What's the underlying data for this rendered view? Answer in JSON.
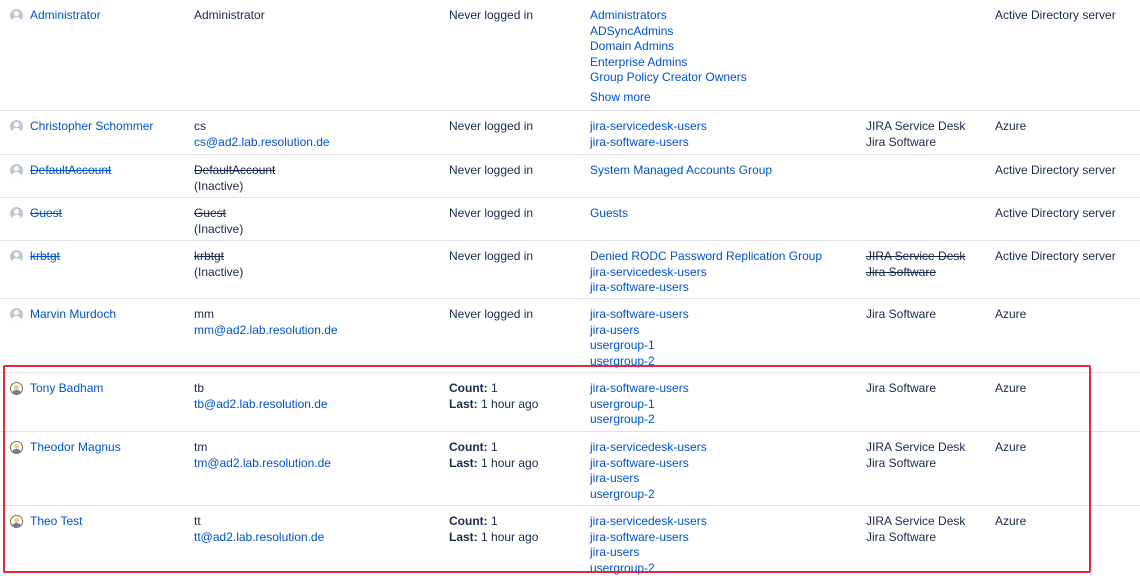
{
  "rows": [
    {
      "name": "Administrator",
      "name_inactive": false,
      "avatar": "default-avatar-icon",
      "username": "Administrator",
      "email": "",
      "inactive_label": "",
      "login_status": "Never logged in",
      "groups": [
        "Administrators",
        "ADSyncAdmins",
        "Domain Admins",
        "Enterprise Admins",
        "Group Policy Creator Owners"
      ],
      "show_more": "Show more",
      "apps": [],
      "apps_struck": false,
      "directory": "Active Directory server"
    },
    {
      "name": "Christopher Schommer",
      "name_inactive": false,
      "avatar": "default-avatar-icon",
      "username": "cs",
      "email": "cs@ad2.lab.resolution.de",
      "inactive_label": "",
      "login_status": "Never logged in",
      "groups": [
        "jira-servicedesk-users",
        "jira-software-users"
      ],
      "apps": [
        "JIRA Service Desk",
        "Jira Software"
      ],
      "apps_struck": false,
      "directory": "Azure"
    },
    {
      "name": "DefaultAccount",
      "name_inactive": true,
      "avatar": "default-avatar-icon",
      "username": "DefaultAccount",
      "email": "",
      "inactive_label": "(Inactive)",
      "login_status": "Never logged in",
      "groups": [
        "System Managed Accounts Group"
      ],
      "apps": [],
      "apps_struck": false,
      "directory": "Active Directory server"
    },
    {
      "name": "Guest",
      "name_inactive": true,
      "avatar": "default-avatar-icon",
      "username": "Guest",
      "email": "",
      "inactive_label": "(Inactive)",
      "login_status": "Never logged in",
      "groups": [
        "Guests"
      ],
      "apps": [],
      "apps_struck": false,
      "directory": "Active Directory server"
    },
    {
      "name": "krbtgt",
      "name_inactive": true,
      "avatar": "default-avatar-icon",
      "username": "krbtgt",
      "email": "",
      "inactive_label": "(Inactive)",
      "login_status": "Never logged in",
      "groups": [
        "Denied RODC Password Replication Group",
        "jira-servicedesk-users",
        "jira-software-users"
      ],
      "apps": [
        "JIRA Service Desk",
        "Jira Software"
      ],
      "apps_struck": true,
      "directory": "Active Directory server"
    },
    {
      "name": "Marvin Murdoch",
      "name_inactive": false,
      "avatar": "default-avatar-icon",
      "username": "mm",
      "email": "mm@ad2.lab.resolution.de",
      "inactive_label": "",
      "login_status": "Never logged in",
      "groups": [
        "jira-software-users",
        "jira-users",
        "usergroup-1",
        "usergroup-2"
      ],
      "apps": [
        "Jira Software"
      ],
      "apps_struck": false,
      "directory": "Azure"
    },
    {
      "name": "Tony Badham",
      "name_inactive": false,
      "avatar": "user-photo-icon",
      "username": "tb",
      "email": "tb@ad2.lab.resolution.de",
      "inactive_label": "",
      "count_label": "Count:",
      "count_value": "1",
      "last_label": "Last:",
      "last_value": "1 hour ago",
      "groups": [
        "jira-software-users",
        "usergroup-1",
        "usergroup-2"
      ],
      "apps": [
        "Jira Software"
      ],
      "apps_struck": false,
      "directory": "Azure"
    },
    {
      "name": "Theodor Magnus",
      "name_inactive": false,
      "avatar": "user-photo-icon",
      "username": "tm",
      "email": "tm@ad2.lab.resolution.de",
      "inactive_label": "",
      "count_label": "Count:",
      "count_value": "1",
      "last_label": "Last:",
      "last_value": "1 hour ago",
      "groups": [
        "jira-servicedesk-users",
        "jira-software-users",
        "jira-users",
        "usergroup-2"
      ],
      "apps": [
        "JIRA Service Desk",
        "Jira Software"
      ],
      "apps_struck": false,
      "directory": "Azure"
    },
    {
      "name": "Theo Test",
      "name_inactive": false,
      "avatar": "user-photo-icon",
      "username": "tt",
      "email": "tt@ad2.lab.resolution.de",
      "inactive_label": "",
      "count_label": "Count:",
      "count_value": "1",
      "last_label": "Last:",
      "last_value": "1 hour ago",
      "groups": [
        "jira-servicedesk-users",
        "jira-software-users",
        "jira-users",
        "usergroup-2"
      ],
      "apps": [
        "JIRA Service Desk",
        "Jira Software"
      ],
      "apps_struck": false,
      "directory": "Azure"
    }
  ],
  "colors": {
    "link": "#0052cc",
    "text": "#172b4d",
    "border": "#dfe1e6",
    "highlight": "#e5283e"
  }
}
